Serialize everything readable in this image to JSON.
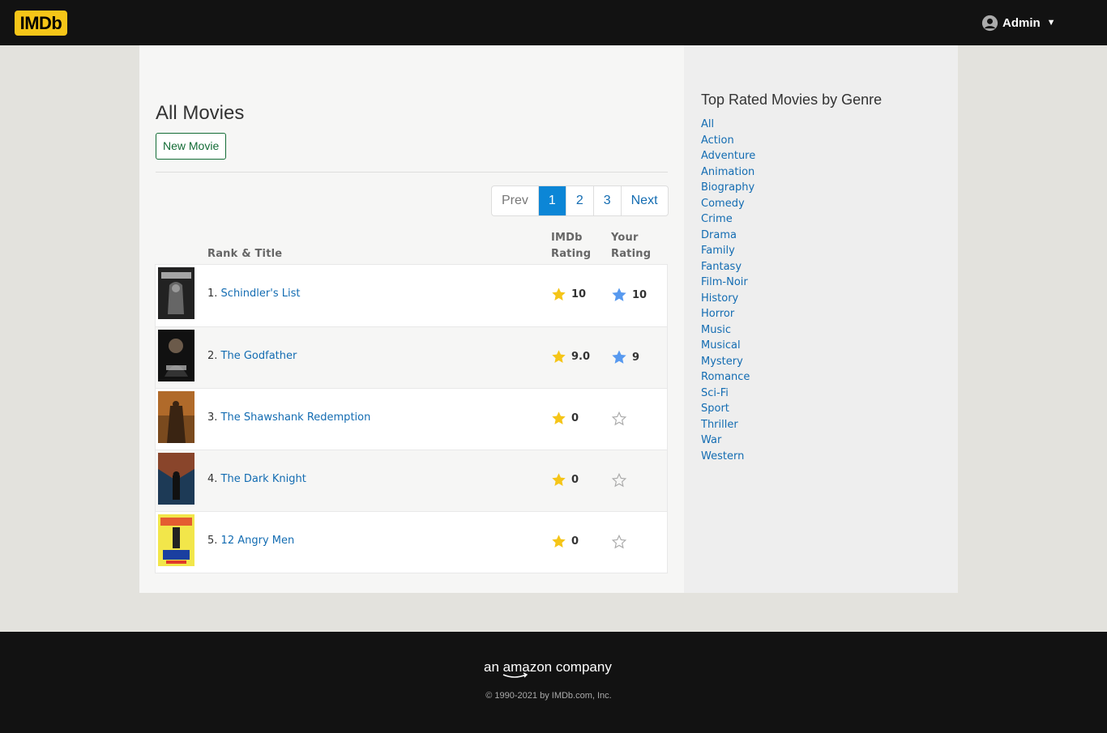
{
  "header": {
    "logo_text": "IMDb",
    "user_name": "Admin",
    "user_caret": "▼",
    "colors": {
      "bar": "#121212",
      "logo": "#f5c518"
    }
  },
  "main": {
    "title": "All Movies",
    "new_button": "New Movie",
    "pagination": {
      "prev": "Prev",
      "pages": [
        "1",
        "2",
        "3"
      ],
      "active": "1",
      "next": "Next"
    },
    "columns": {
      "rank_title": "Rank & Title",
      "imdb_rating_1": "IMDb",
      "imdb_rating_2": "Rating",
      "your_rating_1": "Your",
      "your_rating_2": "Rating"
    },
    "movies": [
      {
        "rank": "1.",
        "title": "Schindler's List",
        "imdb_rating": "10",
        "your_rating": "10",
        "rated": true
      },
      {
        "rank": "2.",
        "title": "The Godfather",
        "imdb_rating": "9.0",
        "your_rating": "9",
        "rated": true
      },
      {
        "rank": "3.",
        "title": "The Shawshank Redemption",
        "imdb_rating": "0",
        "your_rating": "",
        "rated": false
      },
      {
        "rank": "4.",
        "title": "The Dark Knight",
        "imdb_rating": "0",
        "your_rating": "",
        "rated": false
      },
      {
        "rank": "5.",
        "title": "12 Angry Men",
        "imdb_rating": "0",
        "your_rating": "",
        "rated": false
      }
    ],
    "icons": {
      "imdb_star": "star-filled-gold-icon",
      "your_star": "star-filled-blue-icon",
      "unrated_star": "star-outline-icon"
    },
    "colors": {
      "link": "#136cb2",
      "gold_star": "#f5c518",
      "blue_star": "#5799ef",
      "active_page": "#0c86d6",
      "button": "#136c36"
    }
  },
  "sidebar": {
    "title": "Top Rated Movies by Genre",
    "genres": [
      "All",
      "Action",
      "Adventure",
      "Animation",
      "Biography",
      "Comedy",
      "Crime",
      "Drama",
      "Family",
      "Fantasy",
      "Film-Noir",
      "History",
      "Horror",
      "Music",
      "Musical",
      "Mystery",
      "Romance",
      "Sci-Fi",
      "Sport",
      "Thriller",
      "War",
      "Western"
    ]
  },
  "footer": {
    "brand": "an amazon company",
    "copyright": "© 1990-2021 by IMDb.com, Inc."
  }
}
